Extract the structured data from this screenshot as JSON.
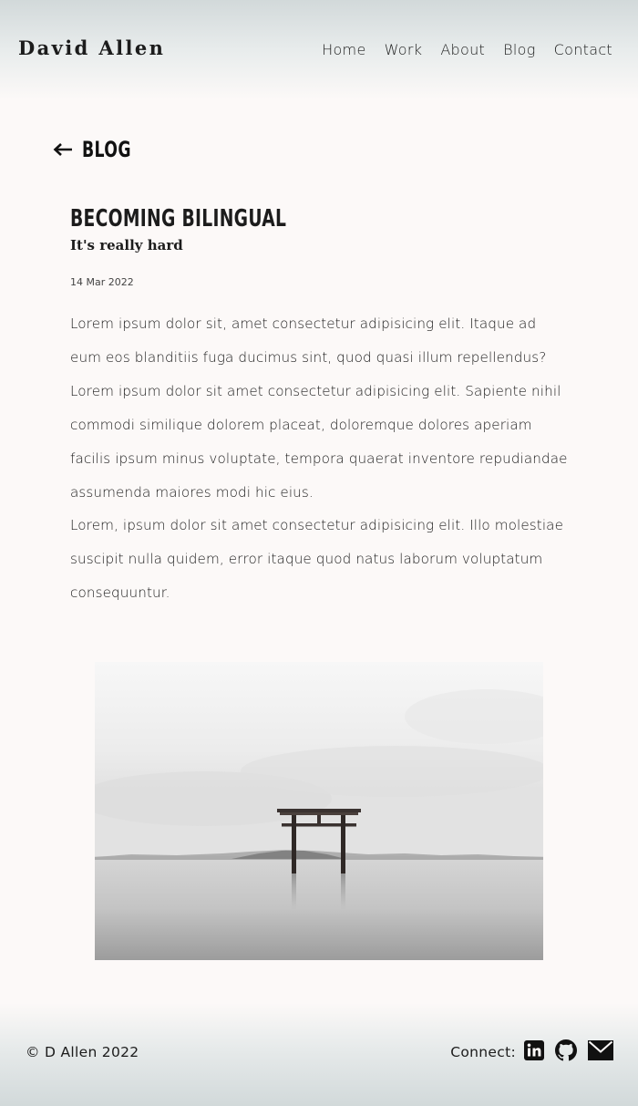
{
  "header": {
    "brand": "David Allen",
    "nav": [
      "Home",
      "Work",
      "About",
      "Blog",
      "Contact"
    ]
  },
  "back_link": {
    "label": "BLOG",
    "icon": "arrow-left-icon"
  },
  "post": {
    "title": "BECOMING BILINGUAL",
    "subtitle": "It's really hard",
    "date": "14 Mar 2022",
    "paragraphs": [
      "Lorem ipsum dolor sit, amet consectetur adipisicing elit. Itaque ad eum eos blanditiis fuga ducimus sint, quod quasi illum repellendus?",
      "Lorem ipsum dolor sit amet consectetur adipisicing elit. Sapiente nihil commodi similique dolorem placeat, doloremque dolores aperiam facilis ipsum minus voluptate, tempora quaerat inventore repudiandae assumenda maiores modi hic eius.",
      "Lorem, ipsum dolor sit amet consectetur adipisicing elit. Illo molestiae suscipit nulla quidem, error itaque quod natus laborum voluptatum consequuntur."
    ]
  },
  "footer": {
    "copyright": "© D Allen 2022",
    "connect_label": "Connect:",
    "socials": [
      "linkedin-icon",
      "github-icon",
      "email-icon"
    ]
  },
  "colors": {
    "background": "#fcf9f8",
    "header_gradient": "#d2d9da",
    "text": "#1c1c1c"
  }
}
